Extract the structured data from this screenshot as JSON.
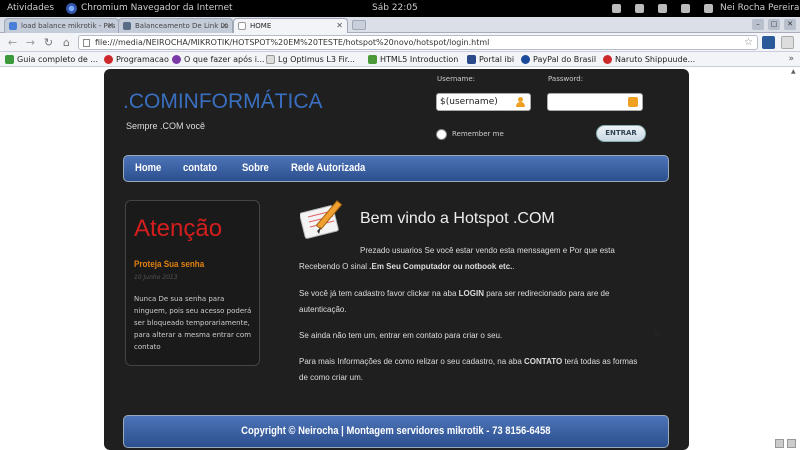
{
  "system": {
    "activities": "Atividades",
    "app_name": "Chromium Navegador da Internet",
    "clock": "Sáb 22:05",
    "user": "Nei Rocha Pereira"
  },
  "tabs": [
    {
      "label": "load balance mikrotik - Pes",
      "favicon_color": "#4a7fd8"
    },
    {
      "label": "Balanceamento De Link Lo",
      "favicon_color": "#5a6b85"
    },
    {
      "label": "HOME",
      "favicon_color": "#ffffff",
      "active": true
    }
  ],
  "address_bar": {
    "url": "file:///media/NEIROCHA/MIKROTIK/HOTSPOT%20EM%20TESTE/hotspot%20novo/hotspot/login.html"
  },
  "bookmarks": [
    {
      "label": "Guia completo de ...",
      "color": "#3a9a3a"
    },
    {
      "label": "Programacao",
      "color": "#cc2a2a"
    },
    {
      "label": "O que fazer após i...",
      "color": "#7a3aa8"
    },
    {
      "label": "Lg Optimus L3 Fir...",
      "color": "#999999"
    },
    {
      "label": "HTML5 Introduction",
      "color": "#4a9a3a"
    },
    {
      "label": "Portal ibi",
      "color": "#2a4a8a"
    },
    {
      "label": "PayPal do Brasil",
      "color": "#1a4a9a"
    },
    {
      "label": "Naruto Shippuude...",
      "color": "#cc2a2a"
    }
  ],
  "site": {
    "logo": ".COMINFORMÁTICA",
    "slogan": "Sempre .COM você",
    "login": {
      "username_label": "Username:",
      "username_value": "$(username)",
      "password_label": "Password:",
      "password_value": "",
      "remember_label": "Remember me",
      "submit_label": "ENTRAR"
    },
    "nav": [
      "Home",
      "contato",
      "Sobre",
      "Rede Autorizada"
    ],
    "sidebar": {
      "title": "Atenção",
      "subtitle": "Proteja Sua senha",
      "date": "10 Junho 2013",
      "text": "Nunca De sua senha para ninguem, pois seu acesso poderá ser bloqueado temporariamente, para alterar a mesma entrar com contato"
    },
    "main": {
      "welcome": "Bem vindo a Hotspot .COM",
      "p1": "Prezado usuarios Se você estar vendo esta menssagem e Por que esta",
      "p1b_prefix": "Recebendo O sinal ",
      "p1b_bold": ".Em Seu Computador ou notbook etc.",
      "p1b_suffix": ".",
      "p2_prefix": "Se você já tem cadastro favor clickar na aba ",
      "p2_bold": "LOGIN",
      "p2_suffix": " para ser redirecionado para are de",
      "p2b": "autenticação.",
      "p3": "Se ainda não tem um, entrar em contato para criar o seu.",
      "p4_prefix": "Para mais Informações de como relizar o seu cadastro, na aba ",
      "p4_bold": "CONTATO",
      "p4_suffix": " terá todas as formas",
      "p4b": "de como criar um."
    },
    "footer": "Copyright © Neirocha | Montagem servidores mikrotik - 73 8156-6458"
  }
}
